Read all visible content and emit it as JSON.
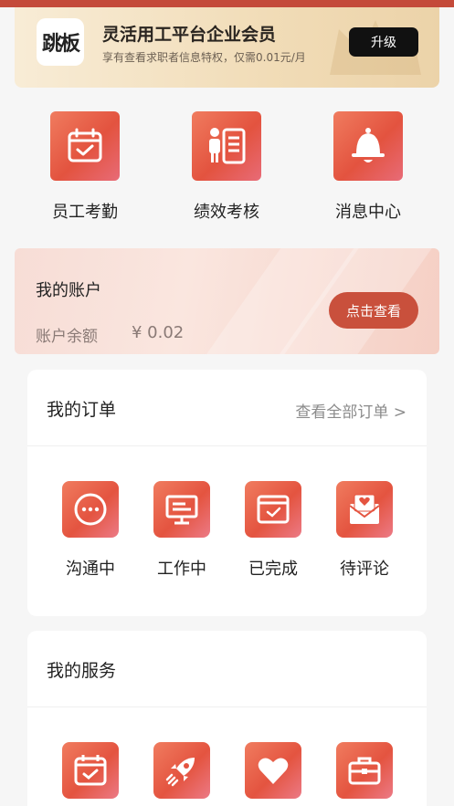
{
  "member": {
    "logo_text": "跳板",
    "title": "灵活用工平台企业会员",
    "subtitle": "享有查看求职者信息特权，仅需0.01元/月",
    "upgrade_label": "升级"
  },
  "quick_actions": [
    {
      "label": "员工考勤",
      "icon": "calendar-check-icon"
    },
    {
      "label": "绩效考核",
      "icon": "person-document-icon"
    },
    {
      "label": "消息中心",
      "icon": "bell-icon"
    }
  ],
  "account": {
    "title": "我的账户",
    "balance_label": "账户余额",
    "balance": "¥ 0.02",
    "view_label": "点击查看"
  },
  "orders": {
    "title": "我的订单",
    "view_all": "查看全部订单 >",
    "items": [
      {
        "label": "沟通中",
        "icon": "chat-bubble-icon"
      },
      {
        "label": "工作中",
        "icon": "desk-icon"
      },
      {
        "label": "已完成",
        "icon": "calendar-done-icon"
      },
      {
        "label": "待评论",
        "icon": "envelope-heart-icon"
      }
    ]
  },
  "services": {
    "title": "我的服务",
    "items": [
      {
        "icon": "calendar-check-icon"
      },
      {
        "icon": "rocket-icon"
      },
      {
        "icon": "heart-icon"
      },
      {
        "icon": "briefcase-icon"
      }
    ]
  },
  "colors": {
    "accent": "#e3533f",
    "button_dark": "#111111",
    "account_button": "#c9503c"
  }
}
